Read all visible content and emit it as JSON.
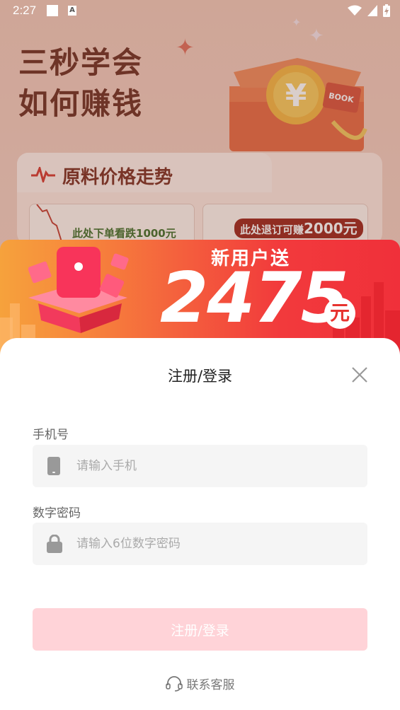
{
  "status_bar": {
    "time": "2:27",
    "notification_icon": "a-icon"
  },
  "background": {
    "headline_line1": "三秒学会",
    "headline_line2": "如何赚钱",
    "trend_title": "原料价格走势",
    "left_card_text": "此处下单看跌1000元",
    "right_card_text": "此处退订可赚",
    "right_card_amount": "2000元"
  },
  "banner": {
    "subtitle": "新用户送",
    "amount": "2475",
    "currency": "元"
  },
  "login": {
    "title": "注册/登录",
    "phone_label": "手机号",
    "phone_placeholder": "请输入手机",
    "password_label": "数字密码",
    "password_placeholder": "请输入6位数字密码",
    "submit_label": "注册/登录",
    "support_label": "联系客服"
  },
  "colors": {
    "banner_start": "#f6a23c",
    "banner_end": "#f0303a",
    "submit_disabled": "#ffd3d8",
    "headline": "#6b2a1c"
  }
}
